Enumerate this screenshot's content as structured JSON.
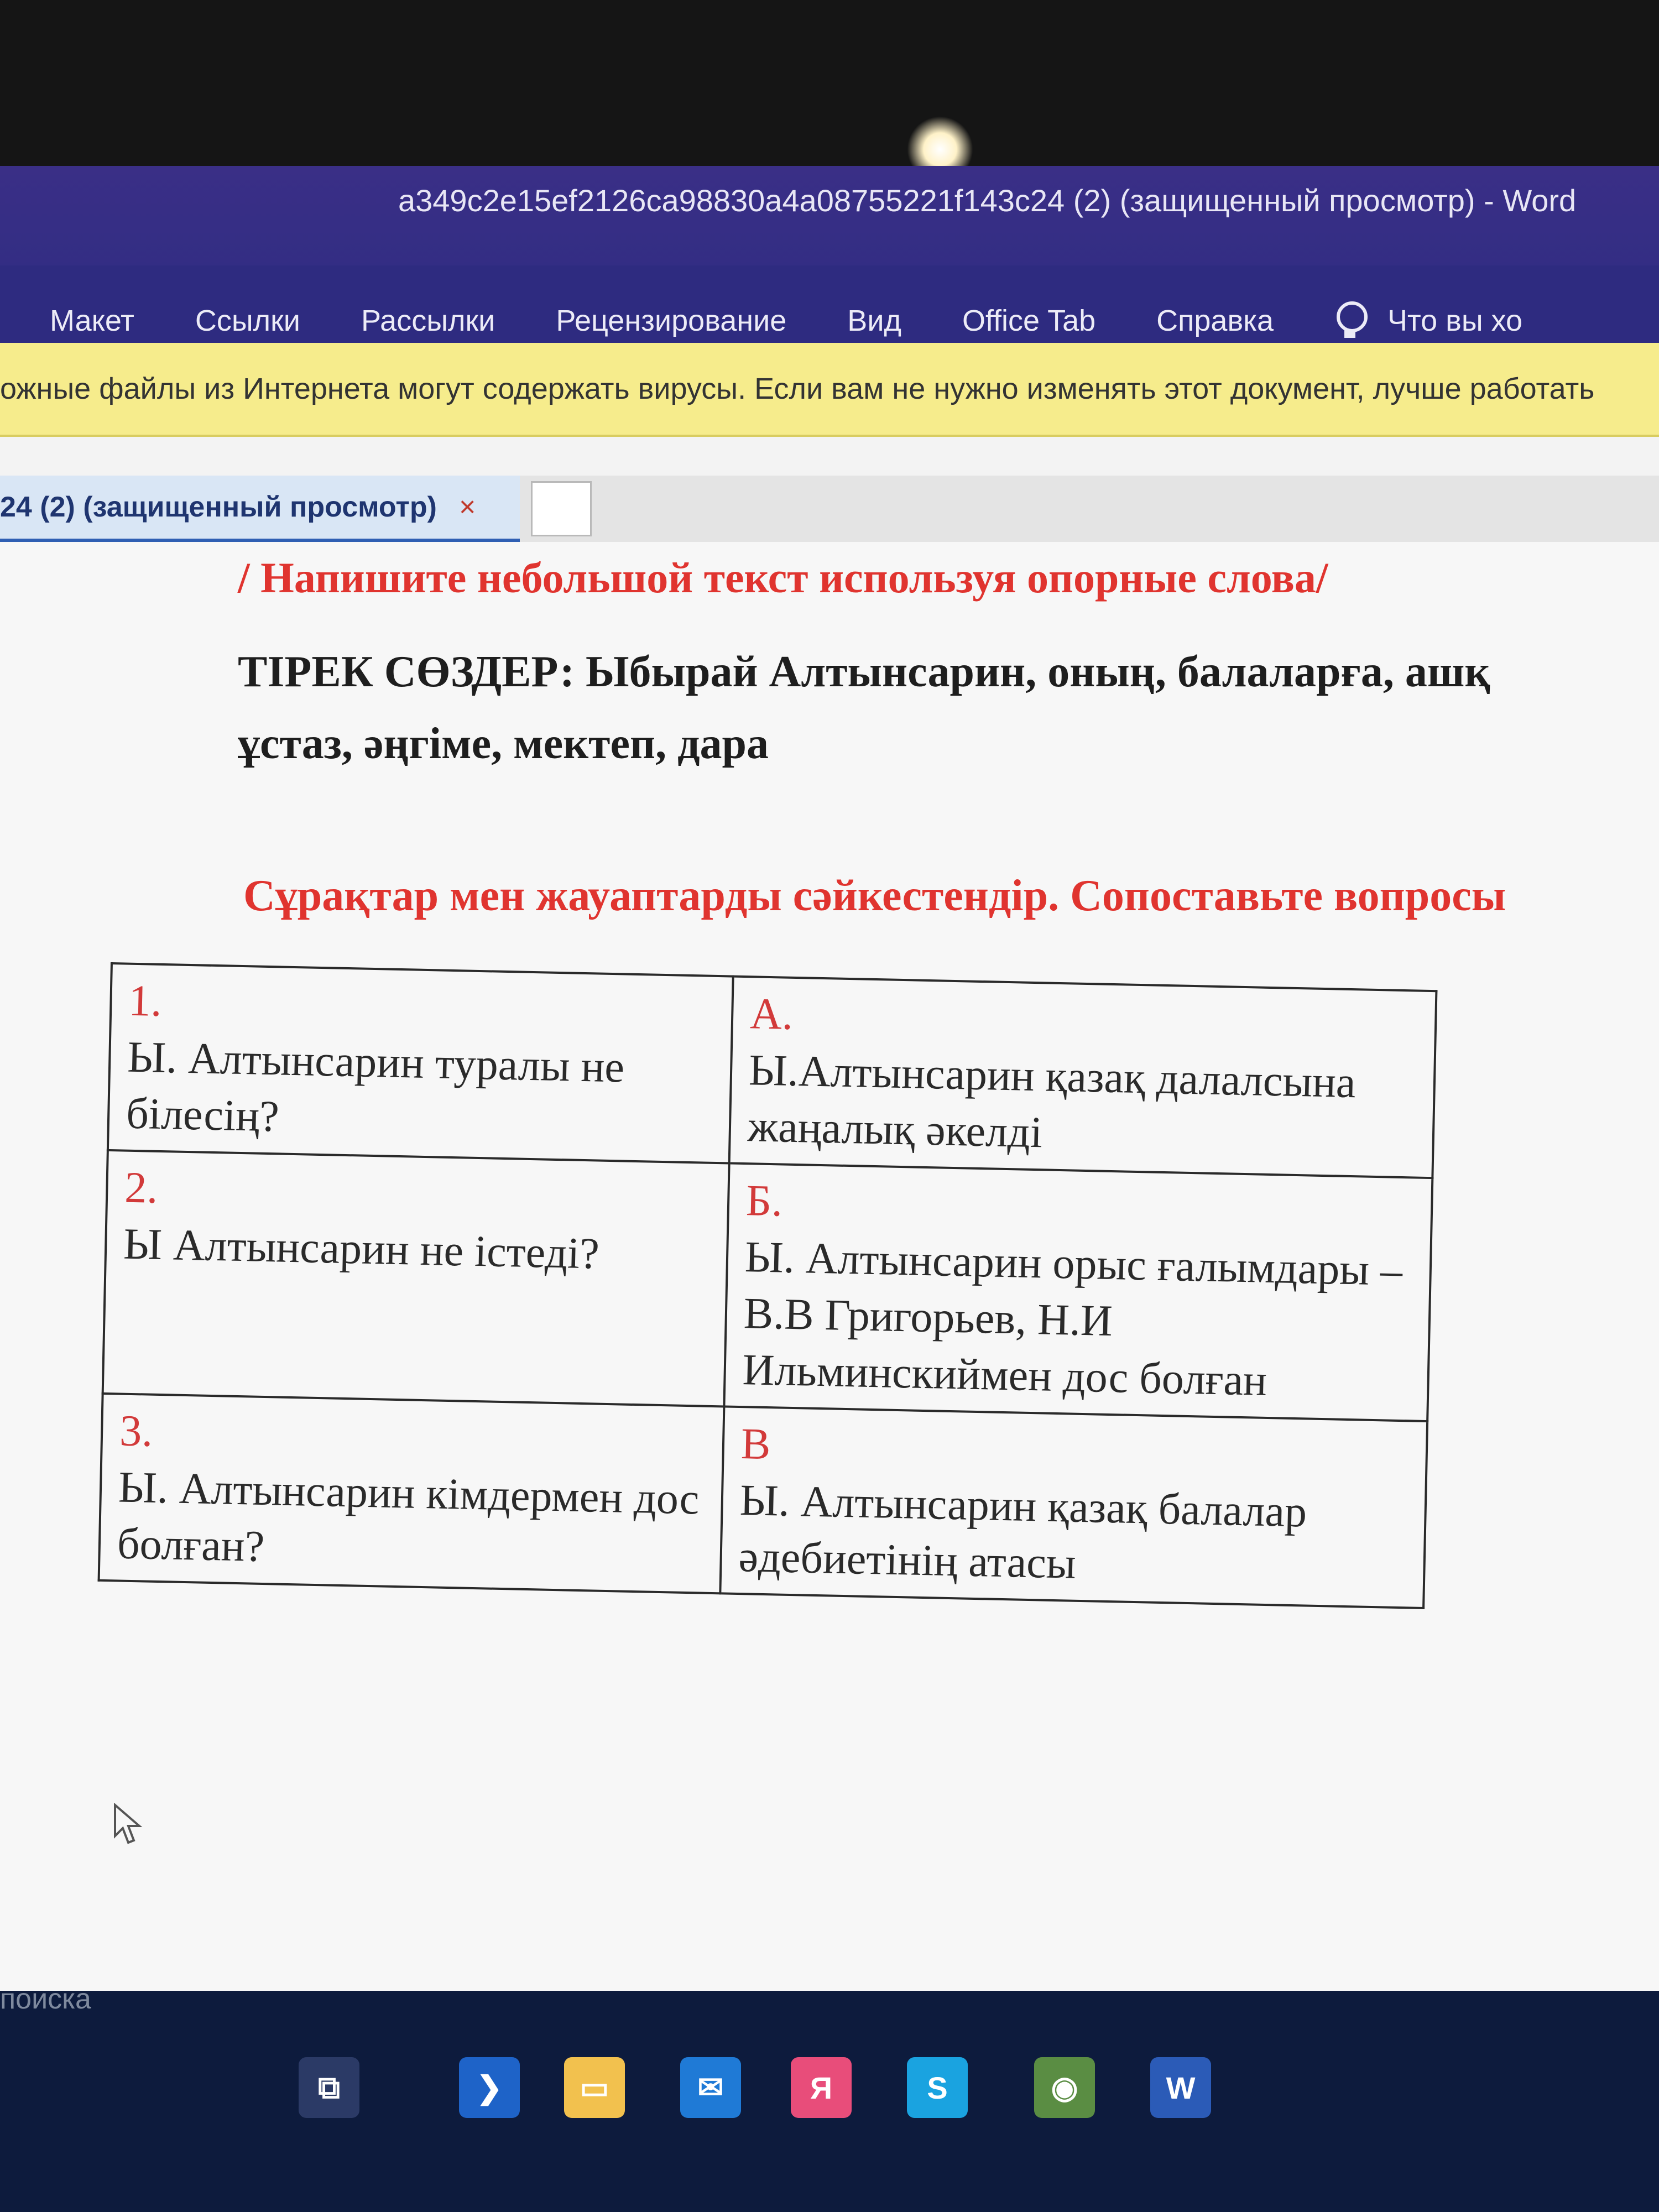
{
  "window": {
    "title": "a349c2e15ef2126ca98830a4a08755221f143c24 (2) (защищенный просмотр)  -  Word"
  },
  "ribbon": {
    "tabs": [
      "Макет",
      "Ссылки",
      "Рассылки",
      "Рецензирование",
      "Вид",
      "Office Tab",
      "Справка"
    ],
    "tell_me": "Что вы хо"
  },
  "protected_view_bar": {
    "message": "ожные файлы из Интернета могут содержать вирусы. Если вам не нужно изменять этот документ, лучше работать"
  },
  "doc_tab": {
    "label": "24 (2) (защищенный просмотр)",
    "close_glyph": "×"
  },
  "document": {
    "instruction_ru": "/ Напишите небольшой текст используя опорные слова/",
    "keywords_label": "ТІРЕК СӨЗДЕР:",
    "keywords_line1": "Ыбырай Алтынсарин, оның, балаларға, ашқ",
    "keywords_line2": "ұстаз, әңгіме, мектеп, дара",
    "matching_title": "Сұрақтар мен жауаптарды сәйкестендір. Сопоставьте вопросы",
    "table": [
      {
        "q_marker": "1.",
        "question": "Ы. Алтынсарин туралы не білесің?",
        "a_marker": "А.",
        "answer": "Ы.Алтынсарин қазақ далалсына жаңалық әкелді"
      },
      {
        "q_marker": "2.",
        "question": "Ы Алтынсарин не істеді?",
        "a_marker": "Б.",
        "answer": "Ы. Алтынсарин орыс ғалымдары – В.В Григорьев, Н.И Ильминскиймен дос болған"
      },
      {
        "q_marker": "3.",
        "question": "Ы. Алтынсарин кімдермен дос болған?",
        "a_marker": "В",
        "answer": "Ы. Алтынсарин қазақ балалар әдебиетінің атасы"
      }
    ]
  },
  "taskbar": {
    "search_text": "поиска",
    "icons": [
      {
        "name": "task-view-icon",
        "glyph": "⧉",
        "color": "#2b3a66"
      },
      {
        "name": "skype-like-icon",
        "glyph": "❯",
        "color": "#1e63c8"
      },
      {
        "name": "file-explorer-icon",
        "glyph": "▭",
        "color": "#f2c14e"
      },
      {
        "name": "mail-icon",
        "glyph": "✉",
        "color": "#1f7ad6"
      },
      {
        "name": "yandex-browser-icon",
        "glyph": "Я",
        "color": "#e84d7a"
      },
      {
        "name": "skype-icon",
        "glyph": "S",
        "color": "#1aa3e0"
      },
      {
        "name": "chrome-icon",
        "glyph": "◉",
        "color": "#5a8d43"
      },
      {
        "name": "word-icon",
        "glyph": "W",
        "color": "#2b5bb7"
      }
    ]
  }
}
